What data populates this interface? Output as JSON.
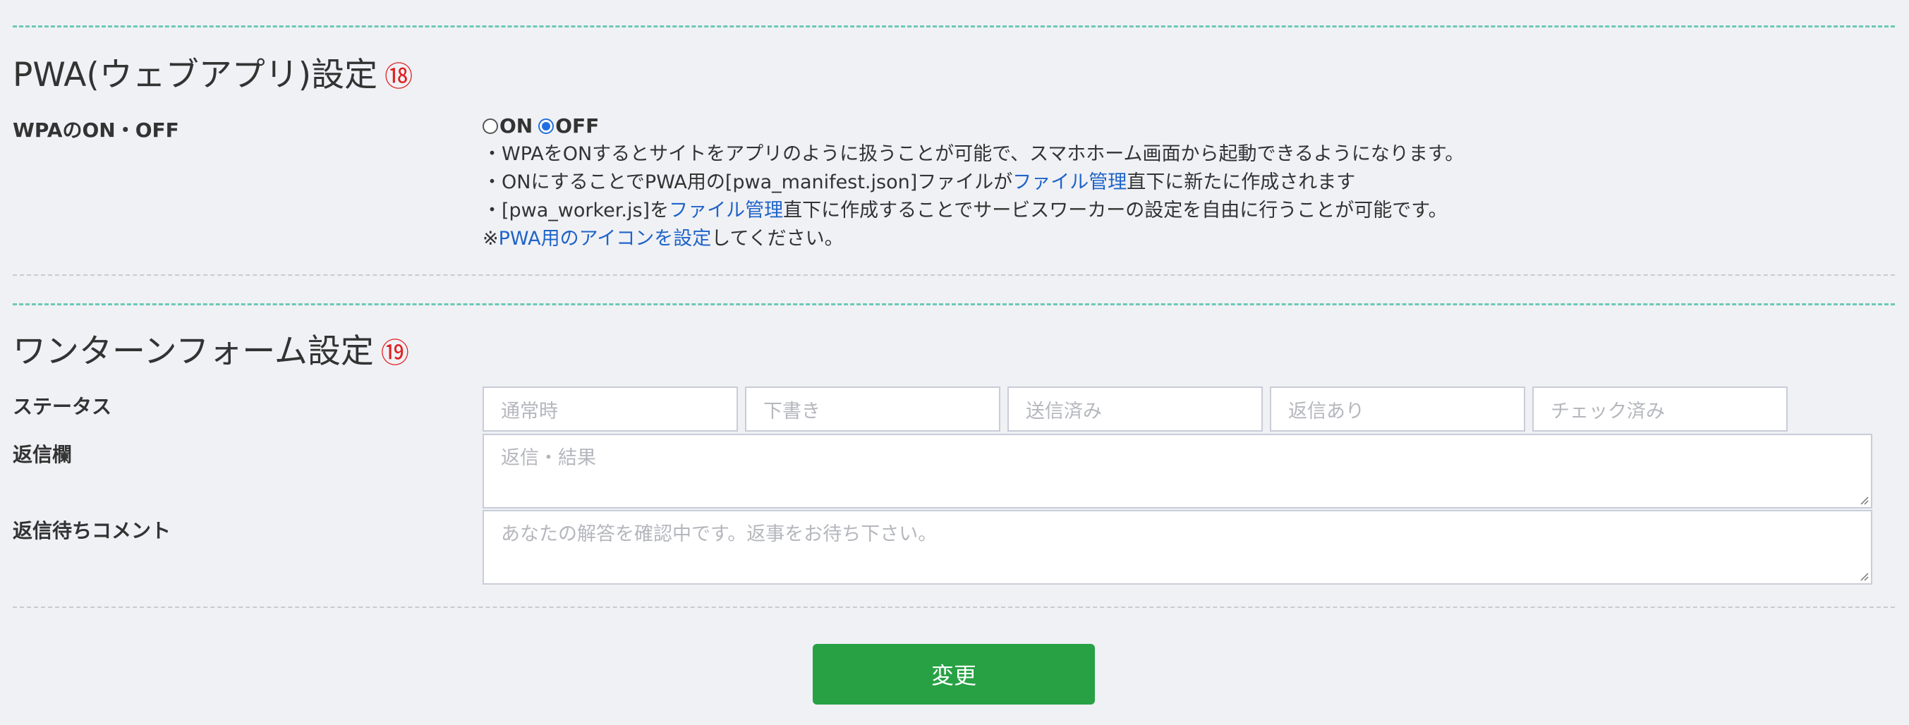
{
  "pwa": {
    "title": "PWA(ウェブアプリ)設定",
    "number": "⑱",
    "label": "WPAのON・OFF",
    "radio_on": "ON",
    "radio_off": "OFF",
    "selected": "OFF",
    "line1": "・WPAをONするとサイトをアプリのように扱うことが可能で、スマホホーム画面から起動できるようになります。",
    "line2_pre": "・ONにすることでPWA用の[pwa_manifest.json]ファイルが",
    "line2_link": "ファイル管理",
    "line2_post": "直下に新たに作成されます",
    "line3_pre": "・[pwa_worker.js]を",
    "line3_link": "ファイル管理",
    "line3_post": "直下に作成することでサービスワーカーの設定を自由に行うことが可能です。",
    "line4_pre": "※",
    "line4_link": "PWA用のアイコンを設定",
    "line4_post": "してください。"
  },
  "wonder": {
    "title": "ワンターンフォーム設定",
    "number": "⑲",
    "status_label": "ステータス",
    "status_placeholders": [
      "通常時",
      "下書き",
      "送信済み",
      "返信あり",
      "チェック済み"
    ],
    "reply_label": "返信欄",
    "reply_placeholder": "返信・結果",
    "waiting_label": "返信待ちコメント",
    "waiting_placeholder": "あなたの解答を確認中です。返事をお待ち下さい。"
  },
  "submit_label": "変更",
  "colors": {
    "accent_teal": "#6cc9b6",
    "number_red": "#e02020",
    "link_blue": "#1f64c8",
    "button_green": "#28a145",
    "radio_blue": "#1f6fe0"
  }
}
